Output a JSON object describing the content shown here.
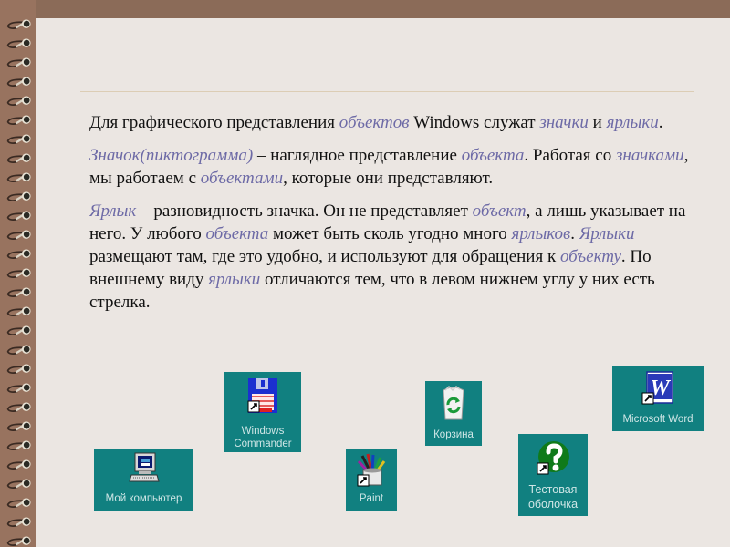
{
  "slide": {
    "paragraphs": [
      {
        "segments": [
          {
            "text": "Для графического представления ",
            "kw": false
          },
          {
            "text": "объектов",
            "kw": true
          },
          {
            "text": " Windows служат ",
            "kw": false
          },
          {
            "text": "значки",
            "kw": true
          },
          {
            "text": " и ",
            "kw": false
          },
          {
            "text": "ярлыки",
            "kw": true
          },
          {
            "text": ".",
            "kw": false
          }
        ]
      },
      {
        "segments": [
          {
            "text": "Значок(пиктограмма)",
            "kw": true
          },
          {
            "text": " – наглядное представление ",
            "kw": false
          },
          {
            "text": "объекта",
            "kw": true
          },
          {
            "text": ". Работая со ",
            "kw": false
          },
          {
            "text": "значками",
            "kw": true
          },
          {
            "text": ", мы работаем с ",
            "kw": false
          },
          {
            "text": "объектами",
            "kw": true
          },
          {
            "text": ", которые они представляют.",
            "kw": false
          }
        ]
      },
      {
        "segments": [
          {
            "text": "Ярлык",
            "kw": true
          },
          {
            "text": " – разновидность значка. Он не представляет ",
            "kw": false
          },
          {
            "text": "объект",
            "kw": true
          },
          {
            "text": ", а лишь указывает на него. У любого ",
            "kw": false
          },
          {
            "text": "объекта",
            "kw": true
          },
          {
            "text": " может быть сколь угодно много ",
            "kw": false
          },
          {
            "text": "ярлыков",
            "kw": true
          },
          {
            "text": ". ",
            "kw": false
          },
          {
            "text": "Ярлыки",
            "kw": true
          },
          {
            "text": " размещают там, где это удобно, и используют для обращения к ",
            "kw": false
          },
          {
            "text": "объекту",
            "kw": true
          },
          {
            "text": ". По внешнему виду ",
            "kw": false
          },
          {
            "text": "ярлыки",
            "kw": true
          },
          {
            "text": " отличаются тем, что в левом нижнем углу у них есть стрелка.",
            "kw": false
          }
        ]
      }
    ]
  },
  "icons": {
    "my_computer": {
      "label": "Мой компьютер",
      "icon": "computer-icon",
      "shortcut": false
    },
    "windows_commander": {
      "label_line1": "Windows",
      "label_line2": "Commander",
      "icon": "floppy-disk-icon",
      "shortcut": true
    },
    "paint": {
      "label": "Paint",
      "icon": "paint-brushes-icon",
      "shortcut": true
    },
    "recycle_bin": {
      "label": "Корзина",
      "icon": "recycle-bin-icon",
      "shortcut": false
    },
    "test_shell": {
      "label_line1": "Тестовая",
      "label_line2": "оболочка",
      "icon": "help-question-icon",
      "shortcut": true
    },
    "ms_word": {
      "label": "Microsoft Word",
      "icon": "word-icon",
      "shortcut": true
    }
  },
  "colors": {
    "background": "#8b6b58",
    "page": "#ebe6e2",
    "keyword": "#6d6aa6",
    "tile": "#118080",
    "tile_text": "#cfe6e6"
  }
}
